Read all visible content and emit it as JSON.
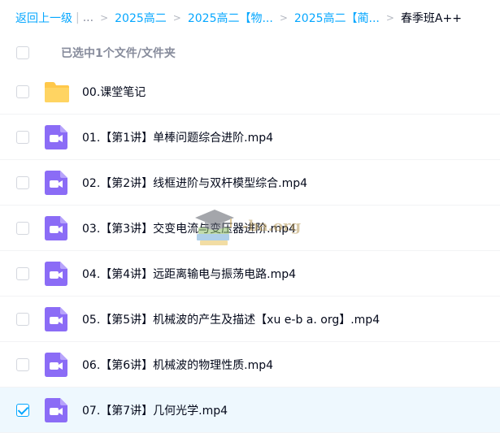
{
  "breadcrumb": {
    "back_label": "返回上一级",
    "separator": "|",
    "ellipsis": "...",
    "arrow": ">",
    "items": [
      {
        "label": "2025高二"
      },
      {
        "label": "2025高二【物..."
      },
      {
        "label": "2025高二【蔺..."
      }
    ],
    "current": "春季班A++"
  },
  "list_header": {
    "selection_label": "已选中1个文件/文件夹"
  },
  "files": [
    {
      "name": "00.课堂笔记",
      "type": "folder",
      "checked": false
    },
    {
      "name": "01.【第1讲】单棒问题综合进阶.mp4",
      "type": "video",
      "checked": false
    },
    {
      "name": "02.【第2讲】线框进阶与双杆模型综合.mp4",
      "type": "video",
      "checked": false
    },
    {
      "name": "03.【第3讲】交变电流与变压器进阶.mp4",
      "type": "video",
      "checked": false
    },
    {
      "name": "04.【第4讲】远距离输电与振荡电路.mp4",
      "type": "video",
      "checked": false
    },
    {
      "name": "05.【第5讲】机械波的产生及描述【xu e-b a. org】.mp4",
      "type": "video",
      "checked": false
    },
    {
      "name": "06.【第6讲】机械波的物理性质.mp4",
      "type": "video",
      "checked": false
    },
    {
      "name": "07.【第7讲】几何光学.mp4",
      "type": "video",
      "checked": true
    }
  ],
  "watermark": {
    "text": "-ba.org",
    "icon": "graduation-cap-books-icon"
  },
  "colors": {
    "link": "#06a7ff",
    "folder": "#ffc84a",
    "video_icon": "#8b6cf6",
    "selected_row": "#eef8fe",
    "text": "#03081a",
    "muted": "#878c9c"
  }
}
